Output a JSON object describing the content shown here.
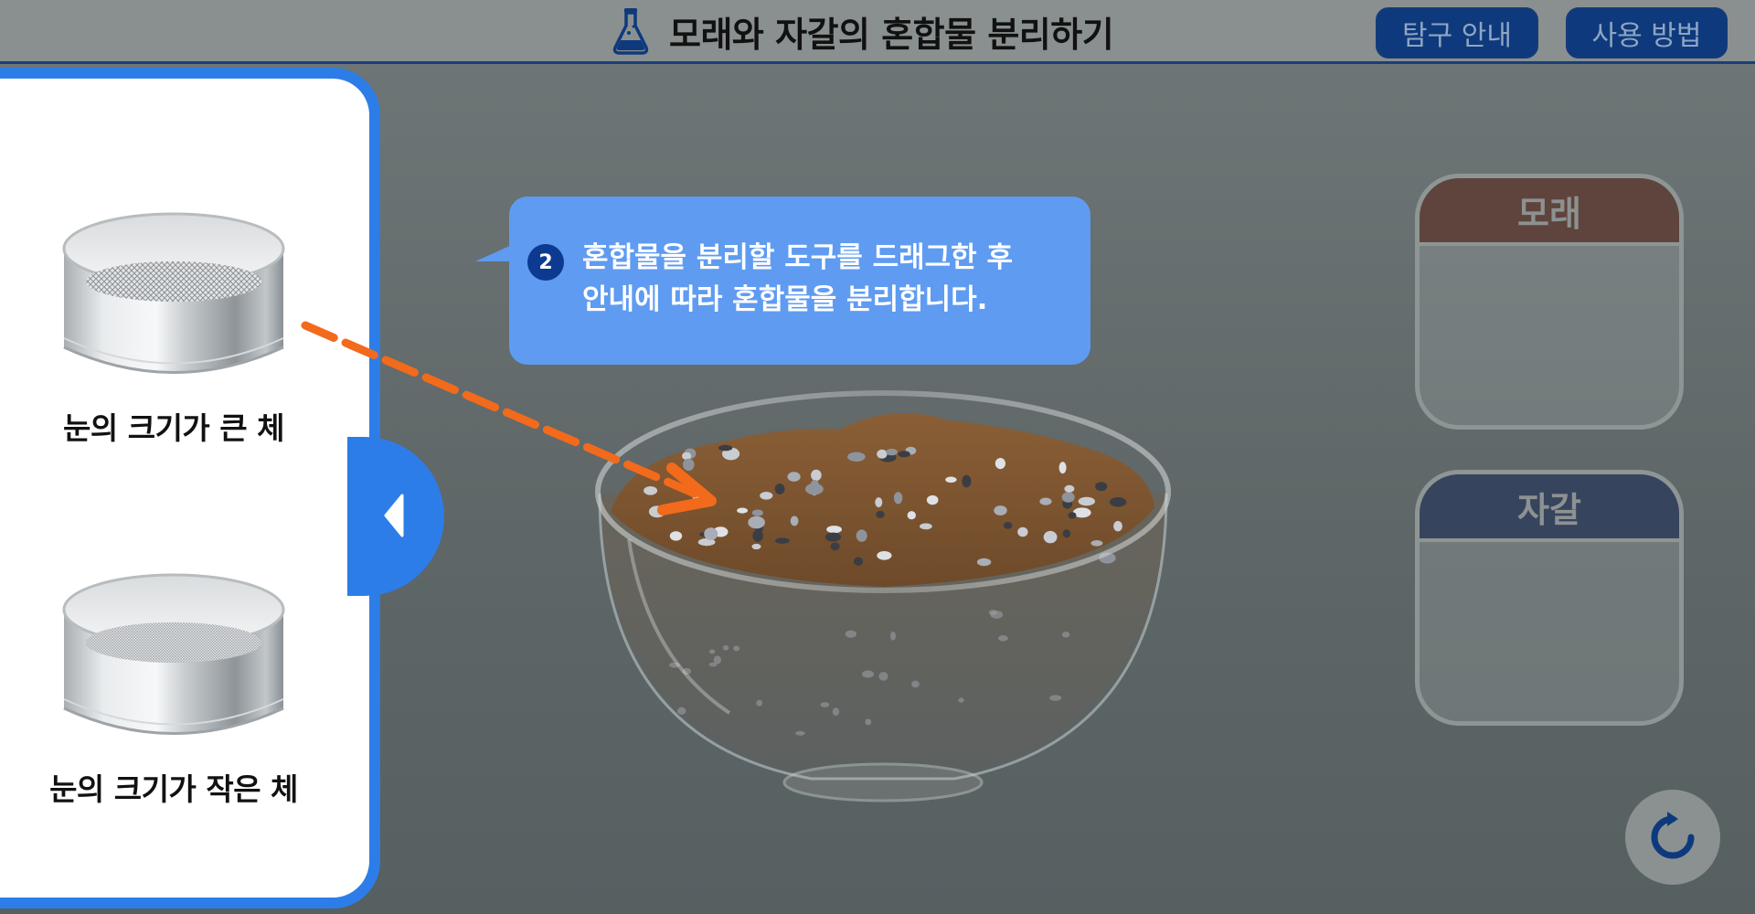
{
  "header": {
    "title": "모래와 자갈의 혼합물 분리하기",
    "icon": "flask-icon",
    "buttons": {
      "guide": "탐구 안내",
      "howto": "사용 방법"
    }
  },
  "tools": [
    {
      "label": "눈의 크기가 큰 체",
      "icon": "large-mesh-sieve-icon"
    },
    {
      "label": "눈의 크기가 작은 체",
      "icon": "small-mesh-sieve-icon"
    }
  ],
  "instruction": {
    "step": "2",
    "lines": [
      "혼합물을 분리할 도구를 드래그한 후",
      "안내에 따라 혼합물을 분리합니다."
    ]
  },
  "results": {
    "sand": "모래",
    "gravel": "자갈"
  },
  "colors": {
    "accent": "#2d7de8",
    "header_button": "#0e3a7d",
    "bubble": "#5f9bf1",
    "hint_arrow": "#f26a1b",
    "sand_header": "#5e443c",
    "gravel_header": "#37445e"
  }
}
